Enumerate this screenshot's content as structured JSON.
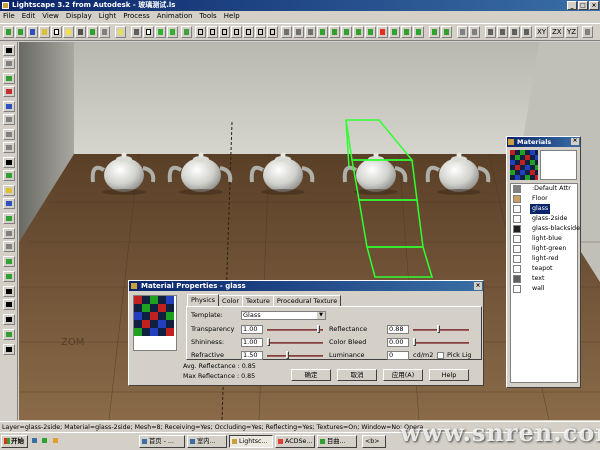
{
  "app": {
    "title": "Lightscape 3.2 from Autodesk - 玻璃测试.ls",
    "window_buttons": [
      "_",
      "□",
      "×"
    ]
  },
  "menu": [
    "File",
    "Edit",
    "View",
    "Display",
    "Light",
    "Process",
    "Animation",
    "Tools",
    "Help"
  ],
  "toolbar": {
    "view_buttons": [
      "XY",
      "ZX",
      "YZ"
    ]
  },
  "materials_panel": {
    "title": "Materials",
    "items": [
      {
        "label": ":Default Attr",
        "swatch": "#808080"
      },
      {
        "label": "Floor",
        "swatch": "#c8a060"
      },
      {
        "label": "glass",
        "swatch": "#ffffff",
        "selected": true
      },
      {
        "label": "glass-2side",
        "swatch": "#ffffff"
      },
      {
        "label": "glass-blackside",
        "swatch": "#202020"
      },
      {
        "label": "light-blue",
        "swatch": "#ffffff"
      },
      {
        "label": "light-green",
        "swatch": "#ffffff"
      },
      {
        "label": "light-red",
        "swatch": "#ffffff"
      },
      {
        "label": "teapot",
        "swatch": "#ffffff"
      },
      {
        "label": "text",
        "swatch": "#606060"
      },
      {
        "label": "wall",
        "swatch": "#ffffff"
      }
    ]
  },
  "dialog": {
    "title": "Material Properties - glass",
    "tabs": [
      "Physics",
      "Color",
      "Texture",
      "Procedural Texture"
    ],
    "template_label": "Template:",
    "template_value": "Glass",
    "transparency_label": "Transparency",
    "transparency_value": "1.00",
    "transparency_level": 0.95,
    "shininess_label": "Shininess:",
    "shininess_value": "1.00",
    "shininess_level": 0.0,
    "refractive_label": "Refractive",
    "refractive_value": "1.50",
    "refractive_level": 0.35,
    "reflectance_label": "Reflectance",
    "reflectance_value": "0.88",
    "reflectance_level": 0.45,
    "color_bleed_label": "Color Bleed",
    "color_bleed_value": "0.00",
    "color_bleed_level": 0.0,
    "luminance_label": "Luminance",
    "luminance_value": "0",
    "luminance_unit": "cd/m2",
    "pick_label": "Pick Lig",
    "avg_reflectance": "Avg. Reflectance : 0.85",
    "max_reflectance": "Max Reflectance : 0.85",
    "buttons": {
      "ok": "确定",
      "cancel": "取消",
      "apply": "应用(A)",
      "help": "Help"
    }
  },
  "statusbar": "Layer=glass-2side; Material=glass-2side; Mesh=8; Receiving=Yes; Occluding=Yes; Reflecting=Yes; Textures=On; Window=No; Opera",
  "taskbar": {
    "start": "开始",
    "tasks": [
      "首页 - ...",
      "室内...",
      "Lightsc...",
      "ACDSe...",
      "目曲..."
    ],
    "tray": "<b>"
  },
  "watermark": "www.snren.com",
  "scene_text": "ZOM",
  "colors": {
    "titlebar": "#0a246a",
    "selection_green": "#30ff30",
    "floor": "#7a5a3c",
    "wall": "#c8c8c0"
  }
}
